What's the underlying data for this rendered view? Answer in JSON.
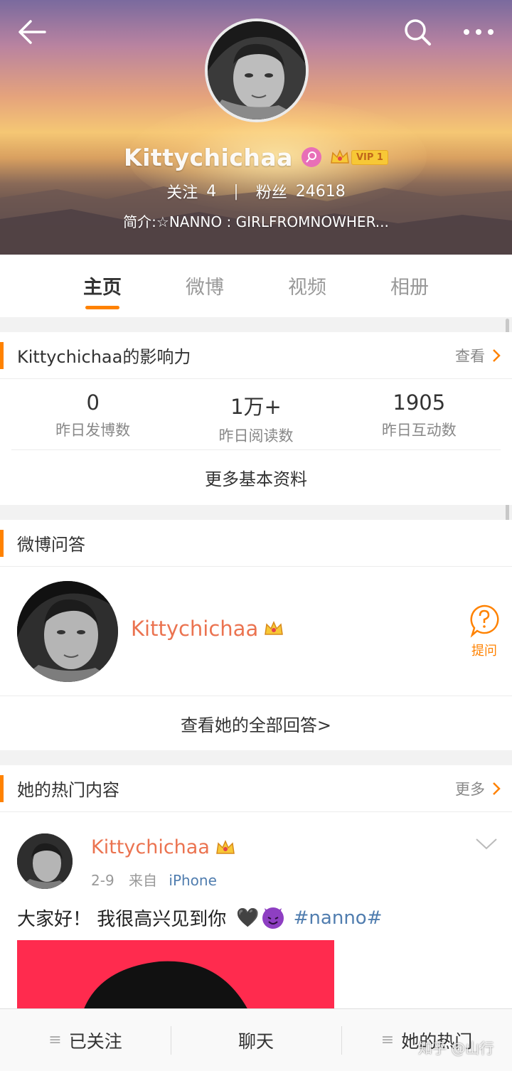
{
  "header": {
    "username": "Kittychichaa",
    "vip_label": "VIP 1",
    "following_label": "关注",
    "following_count": "4",
    "separator": "|",
    "followers_label": "粉丝",
    "followers_count": "24618",
    "bio": "简介:☆NANNO : GIRLFROMNOWHER..."
  },
  "tabs": [
    {
      "label": "主页",
      "active": true
    },
    {
      "label": "微博"
    },
    {
      "label": "视频"
    },
    {
      "label": "相册"
    }
  ],
  "influence": {
    "title": "Kittychichaa的影响力",
    "more_label": "查看",
    "stats": [
      {
        "value": "0",
        "label": "昨日发博数"
      },
      {
        "value": "1万+",
        "label": "昨日阅读数"
      },
      {
        "value": "1905",
        "label": "昨日互动数"
      }
    ],
    "more_info": "更多基本资料"
  },
  "qa": {
    "title": "微博问答",
    "name": "Kittychichaa",
    "ask_label": "提问",
    "view_all": "查看她的全部回答>"
  },
  "hot": {
    "title": "她的热门内容",
    "more_label": "更多",
    "post": {
      "author": "Kittychichaa",
      "date": "2-9",
      "from_label": "来自",
      "source": "iPhone",
      "text": "大家好！ 我很高兴见到你",
      "heart": "🖤",
      "hashtag": "#nanno#"
    }
  },
  "bottom_bar": {
    "followed": "已关注",
    "chat": "聊天",
    "her_hot": "她的热门"
  },
  "watermark": "知乎 @山行",
  "colors": {
    "accent": "#ff8200",
    "name_orange": "#eb7350",
    "link_blue": "#507daf",
    "vip_gold": "#f7c836",
    "gender_pink": "#e86fb7"
  }
}
